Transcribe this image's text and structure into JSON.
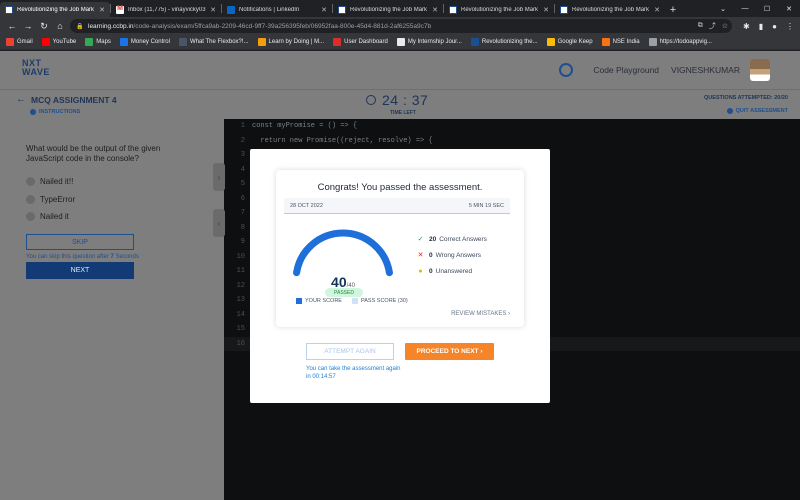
{
  "browser": {
    "tabs": [
      {
        "title": "Revolutionizing the Job Mark",
        "icon": "nxtwave",
        "active": true
      },
      {
        "title": "Inbox (11,775) - vinayvicky03",
        "icon": "gmail",
        "active": false
      },
      {
        "title": "Notifications | LinkedIn",
        "icon": "linkedin",
        "active": false
      },
      {
        "title": "Revolutionizing the Job Mark",
        "icon": "nxtwave",
        "active": false
      },
      {
        "title": "Revolutionizing the Job Mark",
        "icon": "nxtwave",
        "active": false
      },
      {
        "title": "Revolutionizing the Job Mark",
        "icon": "nxtwave",
        "active": false
      }
    ],
    "new_tab": "+",
    "url_host": "learning.ccbp.in",
    "url_path": "/code-analysis/exam/5ffca9ab-2209-46cd-9ff7-39a256395feb/06952faa-800e-45d4-881d-2af6255a9c7b",
    "bookmarks": [
      {
        "label": "Gmail",
        "color": "#ea4335"
      },
      {
        "label": "YouTube",
        "color": "#ff0000"
      },
      {
        "label": "Maps",
        "color": "#34a853"
      },
      {
        "label": "Money Control",
        "color": "#1a73e8"
      },
      {
        "label": "What The Flexbox?!...",
        "color": "#4a5568"
      },
      {
        "label": "Learn by Doing | M...",
        "color": "#f59e0b"
      },
      {
        "label": "User Dashboard",
        "color": "#d93025"
      },
      {
        "label": "My Internship Jour...",
        "color": "#e8eaed"
      },
      {
        "label": "Revolutionizing the...",
        "color": "#1c4e95"
      },
      {
        "label": "Google Keep",
        "color": "#fbbc04"
      },
      {
        "label": "NSE India",
        "color": "#f97316"
      },
      {
        "label": "https://todoappvig...",
        "color": "#9aa0a6"
      }
    ]
  },
  "app": {
    "logo_line1": "NXT",
    "logo_line2": "WAVE",
    "playground_link": "Code Playground",
    "user_name": "VIGNESHKUMAR",
    "assignment_title": "MCQ ASSIGNMENT 4",
    "instructions_link": "INSTRUCTIONS",
    "timer": "24 : 37",
    "time_left_label": "TIME LEFT",
    "questions_attempted": "QUESTIONS ATTEMPTED: 20/20",
    "quit_link": "QUIT ASSESSMENT",
    "progress_fraction": 0.82
  },
  "question": {
    "text": "What would be the output of the given JavaScript code in the console?",
    "options": [
      "Nailed it!!",
      "TypeError",
      "Nailed it"
    ],
    "skip_label": "SKIP",
    "skip_note_prefix": "You can skip this question after ",
    "skip_note_seconds": "7",
    "skip_note_suffix": " Seconds",
    "next_label": "NEXT"
  },
  "editor": {
    "lines": [
      {
        "n": "1",
        "code": "const myPromise = () => {"
      },
      {
        "n": "2",
        "code": "  return new Promise((reject, resolve) => {"
      },
      {
        "n": "3",
        "code": ""
      },
      {
        "n": "4",
        "code": ""
      },
      {
        "n": "5",
        "code": ""
      },
      {
        "n": "6",
        "code": ""
      },
      {
        "n": "7",
        "code": ""
      },
      {
        "n": "8",
        "code": ""
      },
      {
        "n": "9",
        "code": ""
      },
      {
        "n": "10",
        "code": ""
      },
      {
        "n": "11",
        "code": ""
      },
      {
        "n": "12",
        "code": ""
      },
      {
        "n": "13",
        "code": ""
      },
      {
        "n": "14",
        "code": ""
      },
      {
        "n": "15",
        "code": ""
      },
      {
        "n": "16",
        "code": ""
      }
    ],
    "current_line": "16"
  },
  "result_modal": {
    "title": "Congrats! You passed the assessment.",
    "date": "28 OCT 2022",
    "duration": "5 MIN 19 SEC",
    "score": "40",
    "score_max": "/40",
    "score_fraction": 1.0,
    "pass_fraction": 0.75,
    "status": "PASSED",
    "correct_count": "20",
    "correct_label": "Correct Answers",
    "wrong_count": "0",
    "wrong_label": "Wrong Answers",
    "unanswered_count": "0",
    "unanswered_label": "Unanswered",
    "legend_your_score": "YOUR SCORE",
    "legend_pass_score": "PASS SCORE (30)",
    "review_link": "REVIEW MISTAKES",
    "attempt_again_label": "ATTEMPT AGAIN",
    "proceed_label": "PROCEED TO NEXT",
    "retake_note": "You can take the assessment again in 00:14:57",
    "colors": {
      "your_score": "#1e6fd9",
      "pass_score": "#cfe2f8",
      "proceed": "#f6852a",
      "passed_bg": "#d1f5dd",
      "passed_text": "#1c8a44",
      "correct": "#16a34a",
      "wrong": "#dc2626",
      "unanswered": "#eab308"
    }
  }
}
